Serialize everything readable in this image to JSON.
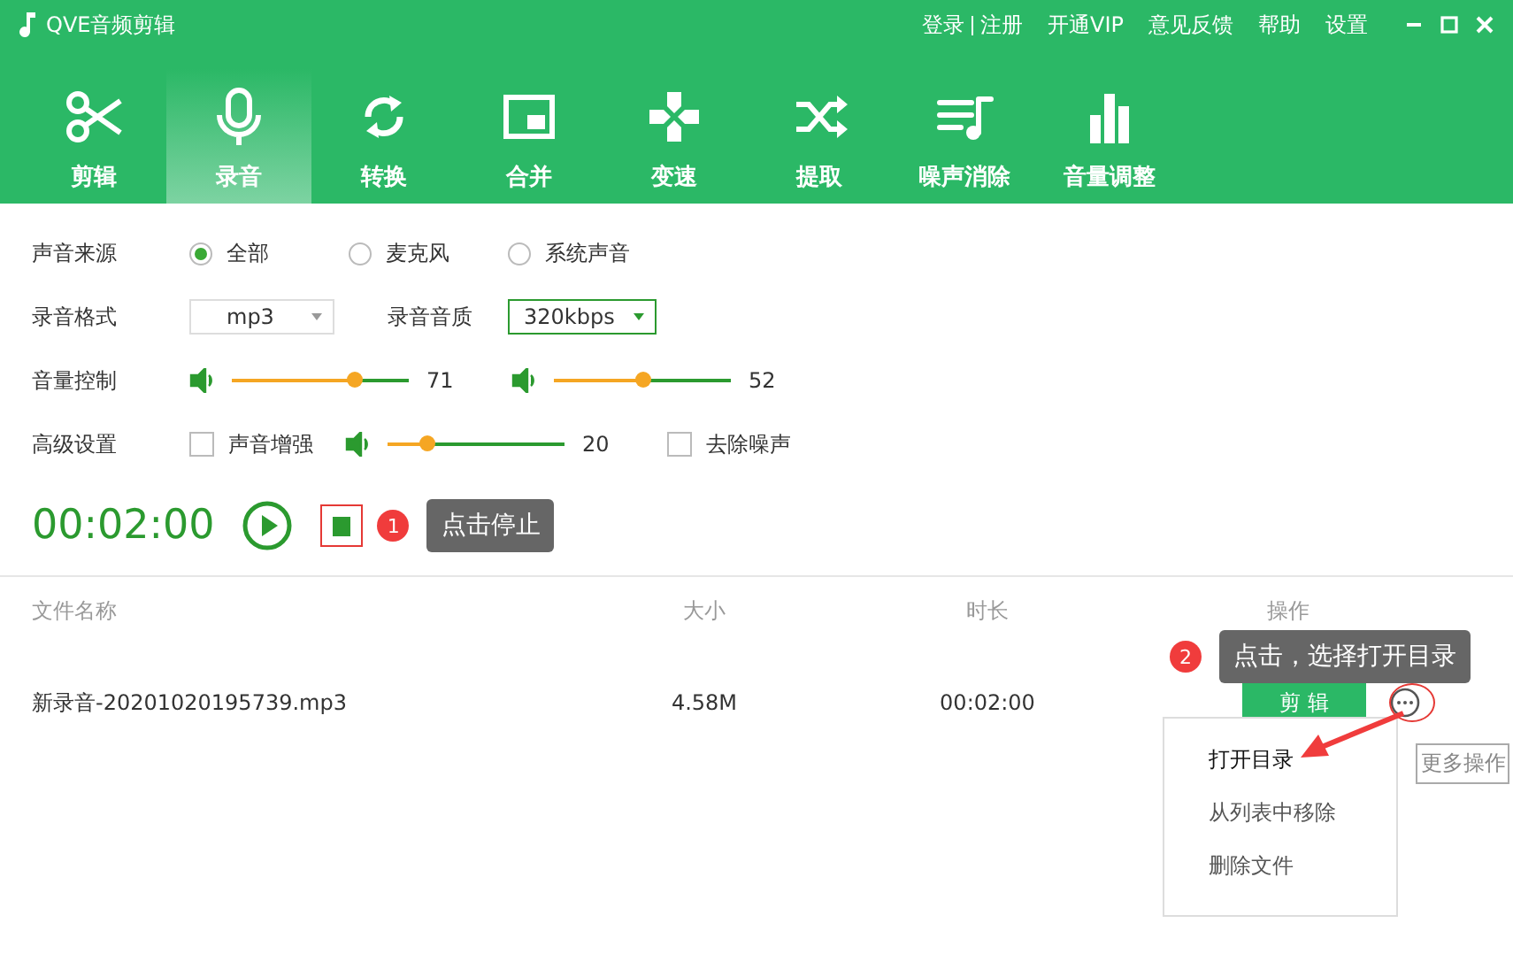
{
  "window": {
    "title": "QVE音频剪辑",
    "account_links": [
      "登录",
      "注册"
    ],
    "links": [
      "开通VIP",
      "意见反馈",
      "帮助",
      "设置"
    ]
  },
  "tabs": [
    {
      "label": "剪辑",
      "kind": "scissors",
      "selected": false
    },
    {
      "label": "录音",
      "kind": "mic",
      "selected": true
    },
    {
      "label": "转换",
      "kind": "convert",
      "selected": false
    },
    {
      "label": "合并",
      "kind": "merge",
      "selected": false
    },
    {
      "label": "变速",
      "kind": "speed",
      "selected": false
    },
    {
      "label": "提取",
      "kind": "extract",
      "selected": false
    },
    {
      "label": "噪声消除",
      "kind": "denoise",
      "selected": false
    },
    {
      "label": "音量调整",
      "kind": "volume",
      "selected": false
    }
  ],
  "source": {
    "label": "声音来源",
    "options": [
      {
        "label": "全部",
        "selected": true
      },
      {
        "label": "麦克风",
        "selected": false
      },
      {
        "label": "系统声音",
        "selected": false
      }
    ]
  },
  "format": {
    "label": "录音格式",
    "value": "mp3",
    "focused": false
  },
  "quality": {
    "label": "录音音质",
    "value": "320kbps",
    "focused": true
  },
  "volume": {
    "label": "音量控制",
    "sliders": [
      {
        "level": 0.69,
        "reading": "71"
      },
      {
        "level": 0.5,
        "reading": "52"
      }
    ]
  },
  "advanced": {
    "label": "高级设置",
    "enhance": {
      "label": "声音增强",
      "checked": false
    },
    "slider": {
      "level": 0.22,
      "reading": "20"
    },
    "denoise": {
      "label": "去除噪声",
      "checked": false
    }
  },
  "recorder": {
    "time": "00:02:00",
    "step": {
      "number": "1",
      "tip": "点击停止"
    }
  },
  "table": {
    "columns": [
      "文件名称",
      "大小",
      "时长",
      "操作"
    ],
    "rows": [
      {
        "cells": [
          "新录音-20201020195739.mp3",
          "4.58M",
          "00:02:00"
        ],
        "action": "剪 辑"
      }
    ]
  },
  "step2": {
    "number": "2",
    "tip": "点击，选择打开目录"
  },
  "menu": {
    "items": [
      {
        "label": "打开目录",
        "selected": true
      },
      {
        "label": "从列表中移除",
        "selected": false
      },
      {
        "label": "删除文件",
        "selected": false
      }
    ]
  },
  "more_tooltip": "更多操作"
}
